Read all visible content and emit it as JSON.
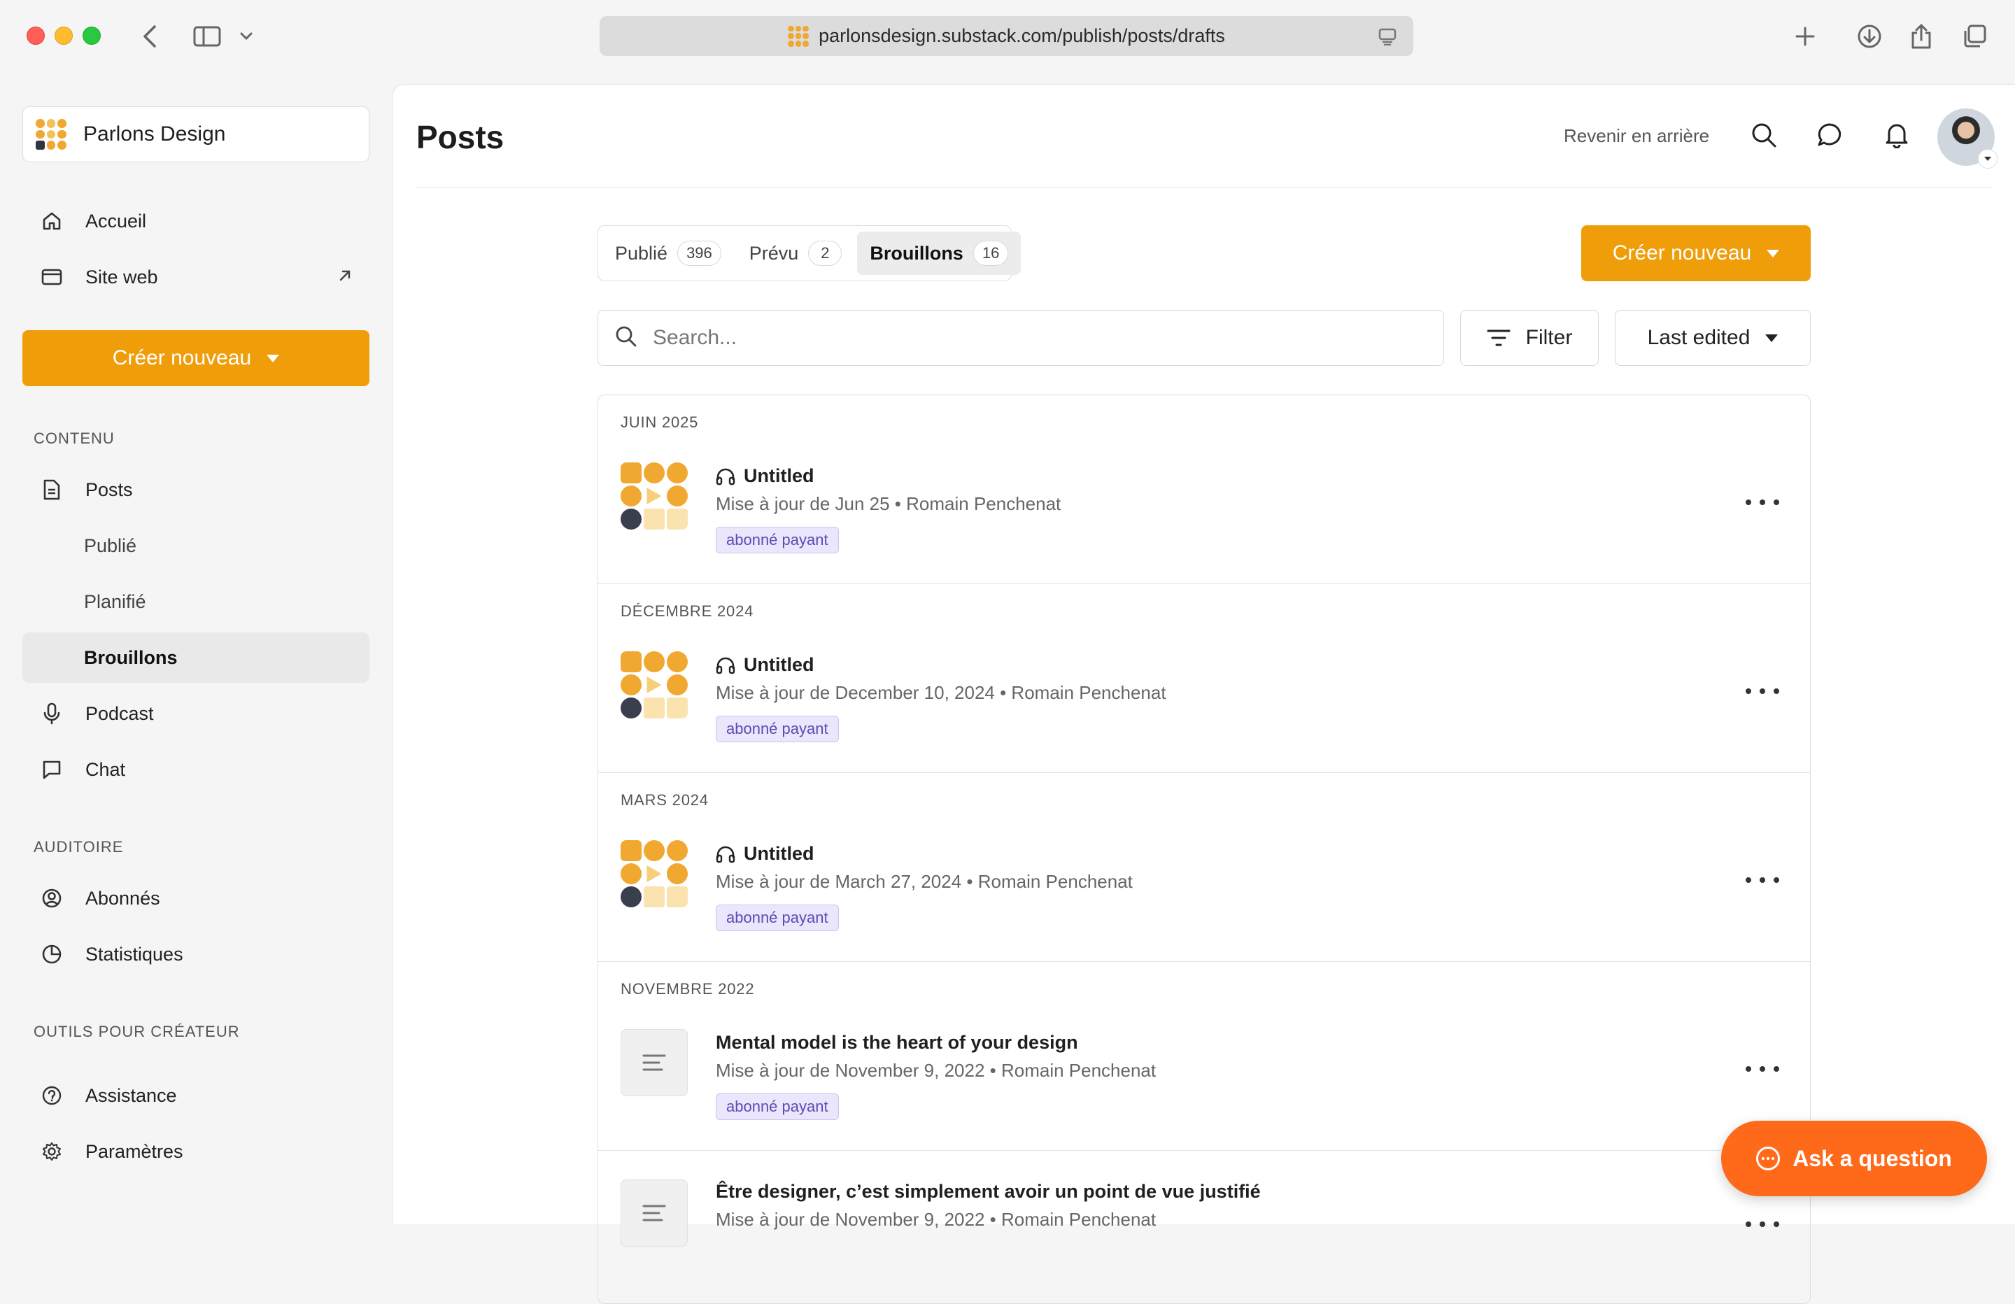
{
  "browser": {
    "url": "parlonsdesign.substack.com/publish/posts/drafts"
  },
  "sidebar": {
    "publication_name": "Parlons Design",
    "nav": {
      "home": "Accueil",
      "website": "Site web"
    },
    "create_label": "Créer nouveau",
    "content_label": "CONTENU",
    "posts": "Posts",
    "published": "Publié",
    "scheduled": "Planifié",
    "drafts": "Brouillons",
    "podcast": "Podcast",
    "chat": "Chat",
    "audience_label": "AUDITOIRE",
    "subscribers": "Abonnés",
    "stats": "Statistiques",
    "creator_tools_label": "OUTILS POUR CRÉATEUR",
    "support": "Assistance",
    "settings": "Paramètres"
  },
  "header": {
    "title": "Posts",
    "back_link": "Revenir en arrière"
  },
  "tabs": [
    {
      "label": "Publié",
      "count": "396"
    },
    {
      "label": "Prévu",
      "count": "2"
    },
    {
      "label": "Brouillons",
      "count": "16"
    }
  ],
  "main": {
    "create_label": "Créer nouveau",
    "search_placeholder": "Search...",
    "filter_label": "Filter",
    "sort_label": "Last edited"
  },
  "groups": [
    {
      "month": "JUIN 2025",
      "title": "Untitled",
      "meta": "Mise à jour de Jun 25 • Romain Penchenat",
      "badge": "abonné payant"
    },
    {
      "month": "DÉCEMBRE 2024",
      "title": "Untitled",
      "meta": "Mise à jour de December 10, 2024 • Romain Penchenat",
      "badge": "abonné payant"
    },
    {
      "month": "MARS 2024",
      "title": "Untitled",
      "meta": "Mise à jour de March 27, 2024 • Romain Penchenat",
      "badge": "abonné payant"
    },
    {
      "month": "NOVEMBRE 2022",
      "title": "Mental model is the heart of your design",
      "meta": "Mise à jour de November 9, 2022 • Romain Penchenat",
      "badge": "abonné payant"
    },
    {
      "month": "",
      "title": "Être designer, c’est simplement avoir un point de vue justifié",
      "meta": "Mise à jour de November 9, 2022 • Romain Penchenat",
      "badge": ""
    }
  ],
  "ask_button": "Ask a question",
  "colors": {
    "accent": "#f09d0a",
    "ask": "#ff6a1a",
    "badge_bg": "#ebe6fb",
    "badge_text": "#5b4bb7"
  }
}
